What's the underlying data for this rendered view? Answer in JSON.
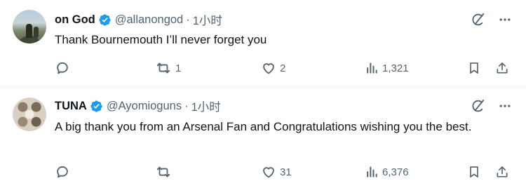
{
  "tweets": [
    {
      "author_name": "on God",
      "handle": "@allanongod",
      "separator": "·",
      "time": "1小时",
      "text": "Thank Bournemouth I’ll never forget you",
      "reply_count": "",
      "repost_count": "1",
      "like_count": "2",
      "view_count": "1,321"
    },
    {
      "author_name": "TUNA",
      "handle": "@Ayomioguns",
      "separator": "·",
      "time": "1小时",
      "text": "A big thank you from an Arsenal Fan and Congratulations wishing you the best.",
      "reply_count": "",
      "repost_count": "",
      "like_count": "31",
      "view_count": "6,376"
    }
  ],
  "icons": {
    "verified": "verified-badge-icon",
    "grok": "grok-icon",
    "more": "more-icon",
    "reply": "reply-icon",
    "repost": "repost-icon",
    "like": "heart-icon",
    "views": "views-icon",
    "bookmark": "bookmark-icon",
    "share": "share-icon"
  },
  "colors": {
    "text_primary": "#0f1419",
    "text_secondary": "#536471",
    "verified_blue": "#1d9bf0",
    "divider": "#eff3f4"
  }
}
